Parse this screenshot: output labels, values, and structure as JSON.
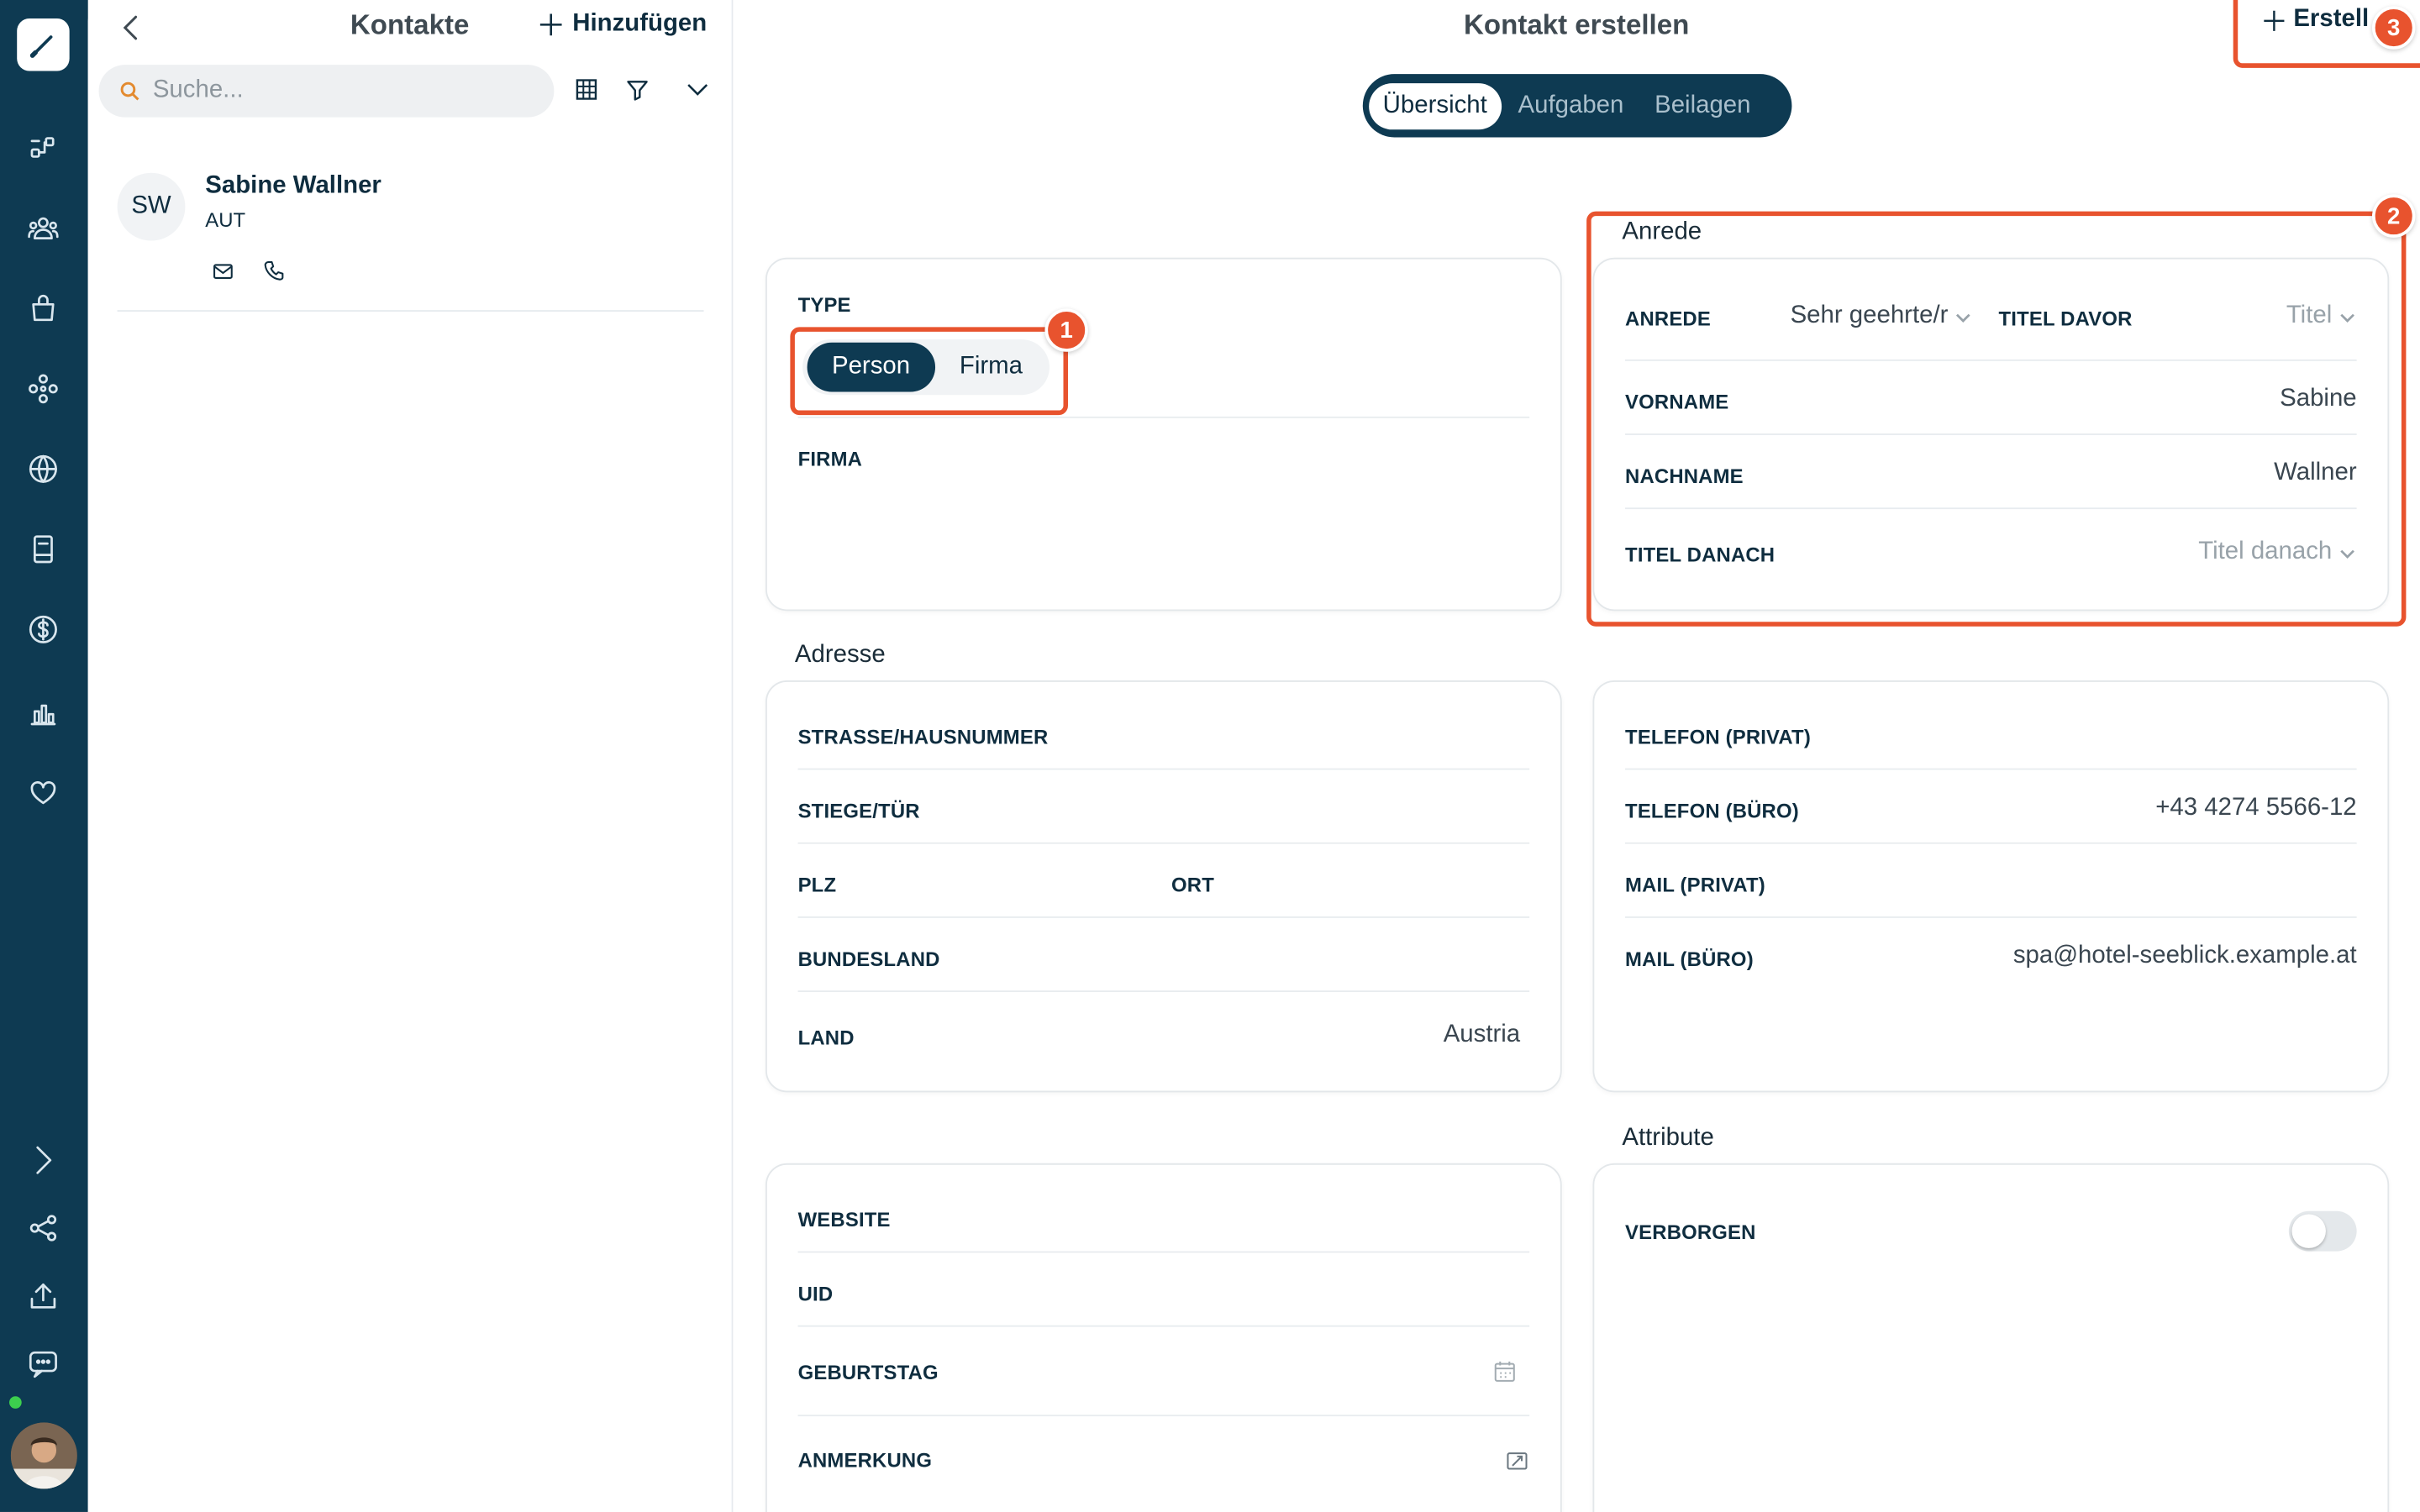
{
  "panel": {
    "title": "Kontakte",
    "add_label": "Hinzufügen",
    "search_placeholder": "Suche..."
  },
  "contacts": [
    {
      "initials": "SW",
      "name": "Sabine Wallner",
      "country": "AUT"
    }
  ],
  "main": {
    "title": "Kontakt erstellen",
    "create_label": "Erstell",
    "tabs": [
      "Übersicht",
      "Aufgaben",
      "Beilagen"
    ]
  },
  "type_card": {
    "type_label": "TYPE",
    "options": [
      "Person",
      "Firma"
    ],
    "selected": "Person",
    "firma_label": "FIRMA"
  },
  "anrede": {
    "section": "Anrede",
    "anrede_label": "ANREDE",
    "anrede_value": "Sehr geehrte/r",
    "titel_davor_label": "TITEL DAVOR",
    "titel_davor_placeholder": "Titel",
    "vorname_label": "VORNAME",
    "vorname_value": "Sabine",
    "nachname_label": "NACHNAME",
    "nachname_value": "Wallner",
    "titel_danach_label": "TITEL DANACH",
    "titel_danach_placeholder": "Titel danach"
  },
  "adresse": {
    "section": "Adresse",
    "strasse_label": "STRASSE/HAUSNUMMER",
    "stiege_label": "STIEGE/TÜR",
    "plz_label": "PLZ",
    "ort_label": "ORT",
    "bundesland_label": "BUNDESLAND",
    "land_label": "LAND",
    "land_value": "Austria"
  },
  "kontakt": {
    "telefon_privat_label": "TELEFON (PRIVAT)",
    "telefon_buero_label": "TELEFON (BÜRO)",
    "telefon_buero_value": "+43 4274 5566-12",
    "mail_privat_label": "MAIL (PRIVAT)",
    "mail_buero_label": "MAIL (BÜRO)",
    "mail_buero_value": "spa@hotel-seeblick.example.at"
  },
  "weitere": {
    "website_label": "WEBSITE",
    "uid_label": "UID",
    "geburtstag_label": "GEBURTSTAG",
    "anmerkung_label": "ANMERKUNG"
  },
  "attribute": {
    "section": "Attribute",
    "verborgen_label": "VERBORGEN",
    "verborgen_on": false
  },
  "badges": [
    "1",
    "2",
    "3"
  ],
  "colors": {
    "rail": "#0e3a52",
    "accent": "#e8532e",
    "online": "#3ccf4e"
  }
}
